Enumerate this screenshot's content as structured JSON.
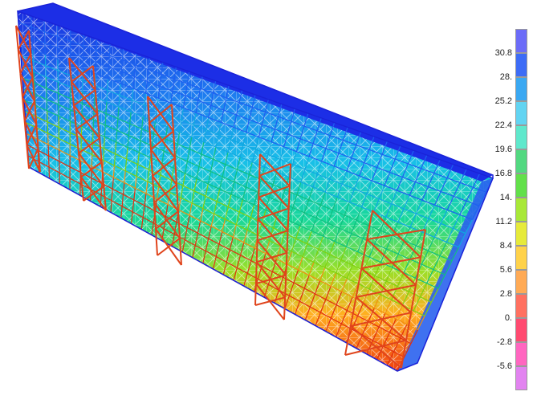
{
  "legend": {
    "labels": [
      "30.8",
      "28.",
      "25.2",
      "22.4",
      "19.6",
      "16.8",
      "14.",
      "11.2",
      "8.4",
      "5.6",
      "2.8",
      "0.",
      "-2.8",
      "-5.6"
    ],
    "colors": [
      "#6c6cf8",
      "#3d6cf6",
      "#3aa8f2",
      "#62d4f2",
      "#5fe8cc",
      "#52d880",
      "#62e04a",
      "#a8e838",
      "#e6ea3a",
      "#ffd24a",
      "#ffaa55",
      "#ff7060",
      "#ff4a70",
      "#ff66c0",
      "#e283f0"
    ]
  },
  "model": {
    "description_icon": "truss-structure-model",
    "top_color": "#1a2fe0",
    "bottom_color": "#e03010",
    "brace_color": "#e0441c"
  }
}
